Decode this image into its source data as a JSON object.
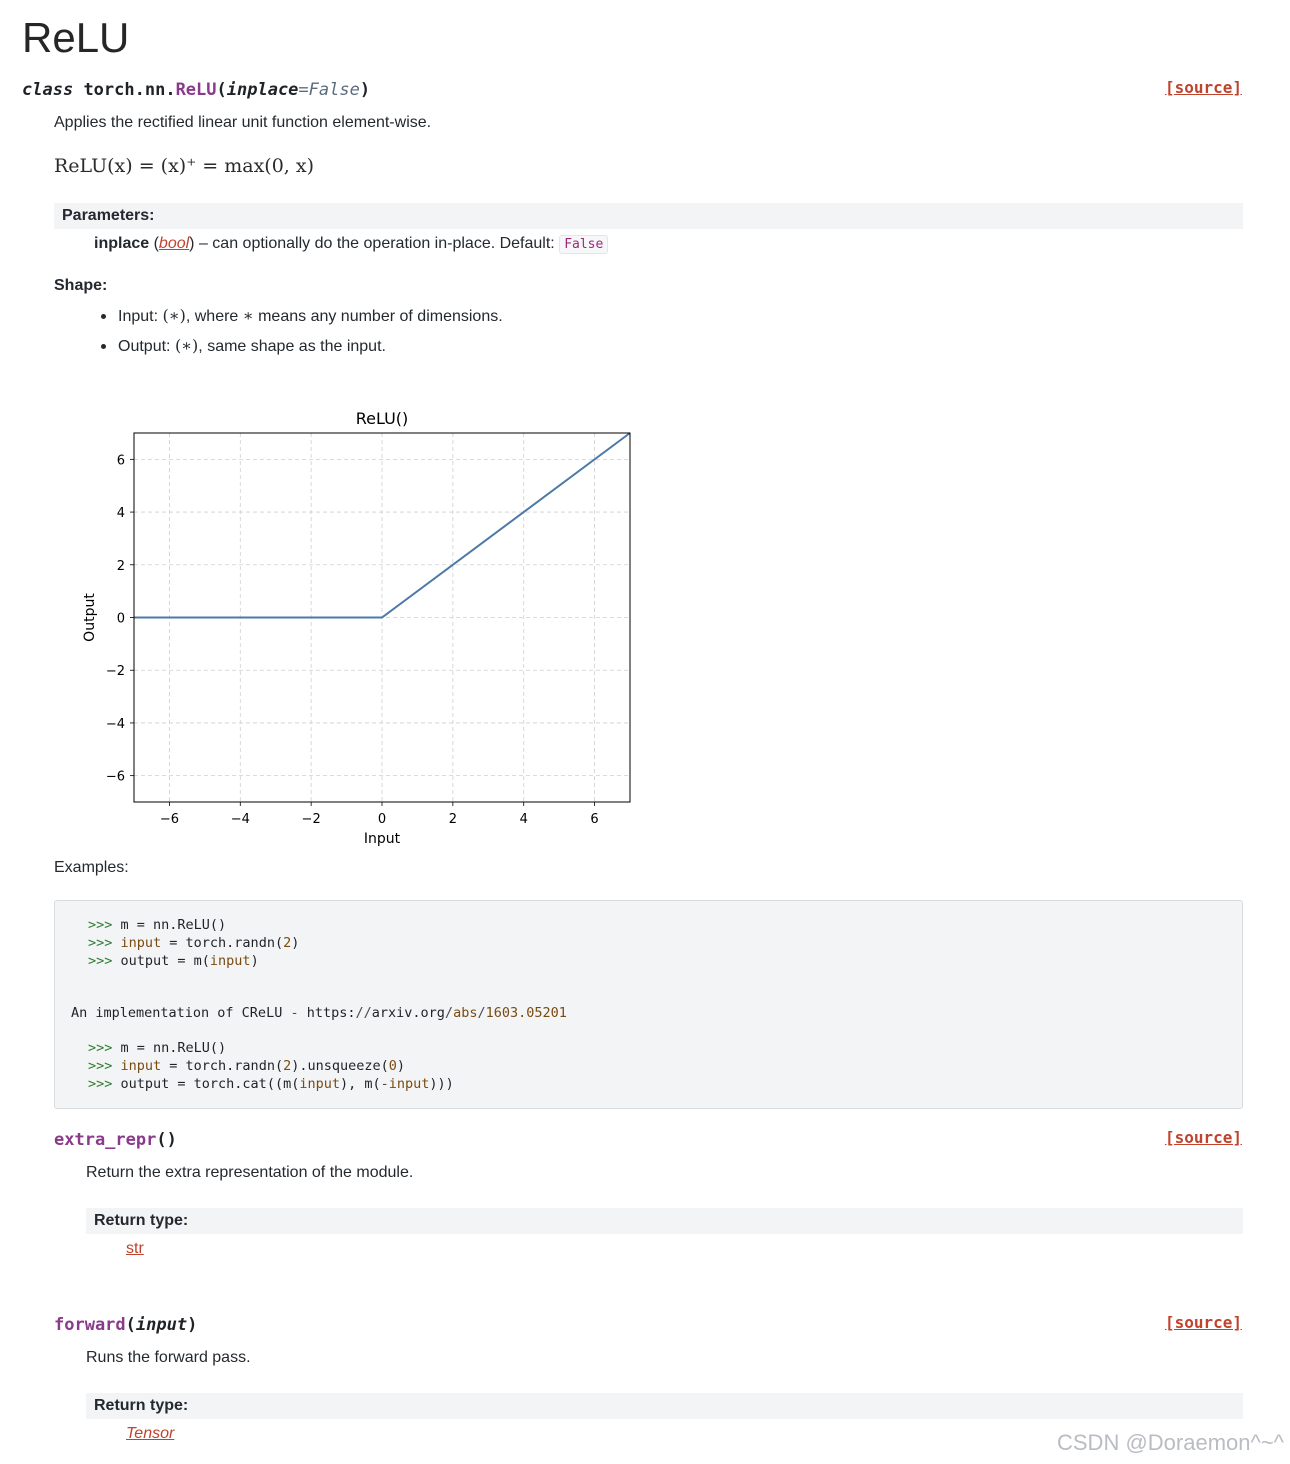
{
  "title": "ReLU",
  "signature": {
    "keyword": "class",
    "module": "torch.nn.",
    "name": "ReLU",
    "open": "(",
    "param": "inplace",
    "eq": "=",
    "default": "False",
    "close": ")",
    "source_label": "[source]"
  },
  "description": "Applies the rectified linear unit function element-wise.",
  "formula": "ReLU(x) = (x)⁺ = max(0, x)",
  "parameters": {
    "heading": "Parameters:",
    "name": "inplace",
    "type_open": "(",
    "type": "bool",
    "type_close": ")",
    "desc": "– can optionally do the operation in-place. Default:",
    "default": "False"
  },
  "shape": {
    "heading": "Shape:",
    "items": [
      {
        "label": "Input:",
        "math": "(∗)",
        "rest": ", where",
        "star": "∗",
        "tail": "means any number of dimensions."
      },
      {
        "label": "Output:",
        "math": "(∗)",
        "rest": ", same shape as the input.",
        "star": "",
        "tail": ""
      }
    ]
  },
  "chart_data": {
    "type": "line",
    "title": "ReLU()",
    "xlabel": "Input",
    "ylabel": "Output",
    "xlim": [
      -7,
      7
    ],
    "ylim": [
      -7,
      7
    ],
    "xticks": [
      -6,
      -4,
      -2,
      0,
      2,
      4,
      6
    ],
    "yticks": [
      -6,
      -4,
      -2,
      0,
      2,
      4,
      6
    ],
    "xtick_labels": [
      "−6",
      "−4",
      "−2",
      "0",
      "2",
      "4",
      "6"
    ],
    "ytick_labels": [
      "−6",
      "−4",
      "−2",
      "0",
      "2",
      "4",
      "6"
    ],
    "grid": true,
    "color": "#4c79a8",
    "series": [
      {
        "x": [
          -7,
          0,
          7
        ],
        "y": [
          0,
          0,
          7
        ]
      }
    ]
  },
  "examples": {
    "heading": "Examples:",
    "code": [
      {
        "prompt": ">>> ",
        "parts": [
          [
            "m = nn.ReLU()",
            ""
          ]
        ]
      },
      {
        "prompt": ">>> ",
        "parts": [
          [
            "input",
            "kw"
          ],
          [
            " = torch.randn(",
            ""
          ],
          [
            "2",
            "num"
          ],
          [
            ")",
            ""
          ]
        ]
      },
      {
        "prompt": ">>> ",
        "parts": [
          [
            "output = m(",
            ""
          ],
          [
            "input",
            "kw"
          ],
          [
            ")",
            ""
          ]
        ]
      }
    ],
    "note": [
      [
        "An implementation of CReLU ",
        ""
      ],
      [
        "-",
        "op"
      ],
      [
        " https:",
        ""
      ],
      [
        "//",
        "op"
      ],
      [
        "arxiv.org",
        ""
      ],
      [
        "/",
        "op"
      ],
      [
        "abs",
        "kw"
      ],
      [
        "/",
        "op"
      ],
      [
        "1603.05201",
        "num"
      ]
    ],
    "code2": [
      {
        "prompt": ">>> ",
        "parts": [
          [
            "m = nn.ReLU()",
            ""
          ]
        ]
      },
      {
        "prompt": ">>> ",
        "parts": [
          [
            "input",
            "kw"
          ],
          [
            " = torch.randn(",
            ""
          ],
          [
            "2",
            "num"
          ],
          [
            ").unsqueeze(",
            ""
          ],
          [
            "0",
            "num"
          ],
          [
            ")",
            ""
          ]
        ]
      },
      {
        "prompt": ">>> ",
        "parts": [
          [
            "output = torch.cat((m(",
            ""
          ],
          [
            "input",
            "kw"
          ],
          [
            "), m(",
            ""
          ],
          [
            "-",
            "op"
          ],
          [
            "input",
            "kw"
          ],
          [
            ")))",
            ""
          ]
        ]
      }
    ]
  },
  "methods": [
    {
      "name": "extra_repr",
      "open": "()",
      "param": "",
      "close": "",
      "source_label": "[source]",
      "description": "Return the extra representation of the module.",
      "return_heading": "Return type:",
      "return_type": "str"
    },
    {
      "name": "forward",
      "open": "(",
      "param": "input",
      "close": ")",
      "source_label": "[source]",
      "description": "Runs the forward pass.",
      "return_heading": "Return type:",
      "return_type": "Tensor"
    }
  ],
  "watermark": "CSDN @Doraemon^~^"
}
